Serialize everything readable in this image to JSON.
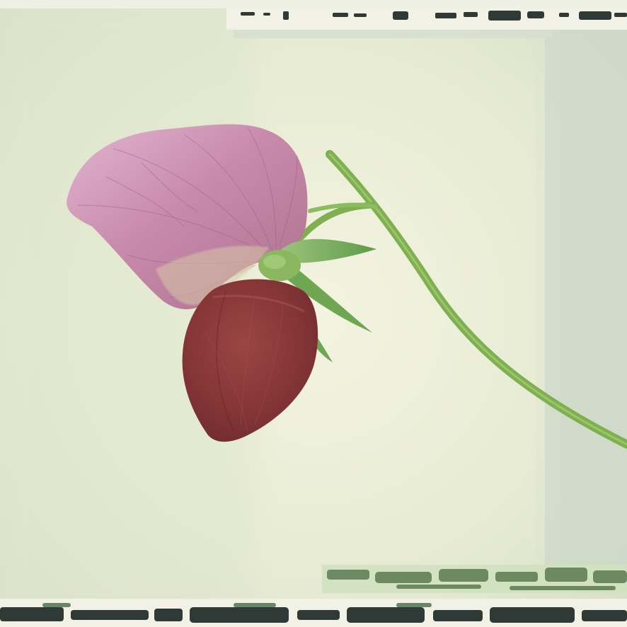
{
  "image": {
    "subject": "",
    "colors": {
      "background_light": "#eef0da",
      "background_shadow": "#d3ddc6",
      "left_panel": "#dfe6cd",
      "right_panel": "#ccd7c8",
      "frame_edge": "#f1f1e6",
      "emulsion_dark": "#2f3a36",
      "emulsion_green": "#5b7a52",
      "petal_pink": "#c88aac",
      "petal_pink_light": "#e2b6cf",
      "petal_vein": "#9a5a7c",
      "keel_red": "#8e3a3a",
      "keel_red_dark": "#6e2a2c",
      "sepal_green": "#5f9a4a",
      "sepal_green_light": "#9cc47c",
      "stem_green": "#7fb050",
      "stem_green_dark": "#5d8f3a"
    }
  }
}
